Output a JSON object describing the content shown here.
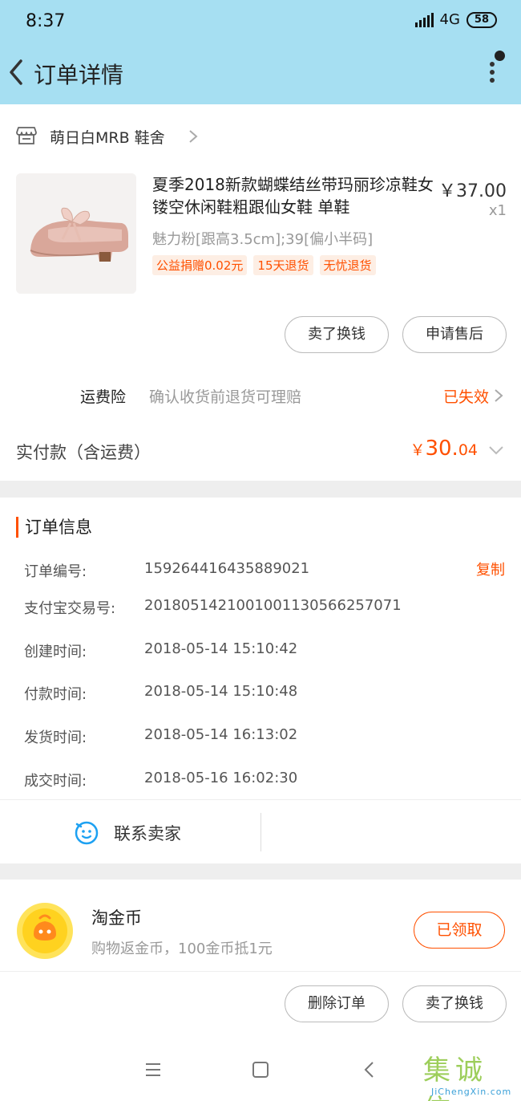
{
  "status_bar": {
    "time": "8:37",
    "network": "4G",
    "battery": "58"
  },
  "header": {
    "title": "订单详情"
  },
  "shop": {
    "name": "萌日白MRB 鞋舍"
  },
  "product": {
    "title": "夏季2018新款蝴蝶结丝带玛丽珍凉鞋女镂空休闲鞋粗跟仙女鞋 单鞋",
    "price": "￥37.00",
    "quantity": "x1",
    "sku": "魅力粉[跟高3.5cm];39[偏小半码]",
    "tags": [
      "公益捐赠0.02元",
      "15天退货",
      "无忧退货"
    ],
    "actions": {
      "sell_label": "卖了换钱",
      "after_sale_label": "申请售后"
    }
  },
  "insurance": {
    "label": "运费险",
    "desc": "确认收货前退货可理赔",
    "status": "已失效"
  },
  "payment": {
    "label": "实付款（含运费）",
    "currency": "￥",
    "integer": "30.",
    "decimal": "04"
  },
  "order_info": {
    "heading": "订单信息",
    "copy_label": "复制",
    "rows": [
      {
        "key": "订单编号:",
        "value": "159264416435889021"
      },
      {
        "key": "支付宝交易号:",
        "value": "2018051421001001130566257071"
      },
      {
        "key": "创建时间:",
        "value": "2018-05-14 15:10:42"
      },
      {
        "key": "付款时间:",
        "value": "2018-05-14 15:10:48"
      },
      {
        "key": "发货时间:",
        "value": "2018-05-14 16:13:02"
      },
      {
        "key": "成交时间:",
        "value": "2018-05-16 16:02:30"
      }
    ],
    "contact_label": "联系卖家"
  },
  "coin": {
    "title": "淘金币",
    "desc": "购物返金币，100金币抵1元",
    "button_label": "已领取",
    "actions": {
      "delete_label": "删除订单",
      "sell_label": "卖了换钱"
    }
  },
  "watermark": {
    "text": "集诚信",
    "url": "JiChengXin.com"
  },
  "colors": {
    "accent": "#ff5000",
    "header_bg": "#a6dff2"
  },
  "icons": [
    "back-arrow-icon",
    "more-vertical-icon",
    "shop-icon",
    "chevron-right-icon",
    "chevron-down-icon",
    "smiley-chat-icon",
    "coin-icon",
    "menu-icon",
    "home-square-icon",
    "back-triangle-icon"
  ]
}
